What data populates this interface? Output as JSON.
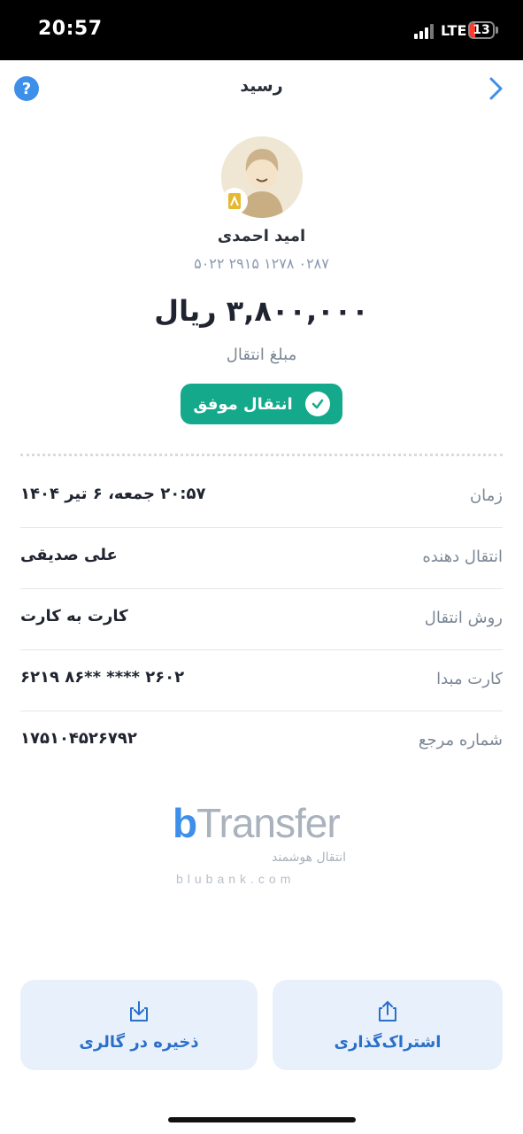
{
  "status_bar": {
    "time": "20:57",
    "network": "LTE",
    "battery_level": "13"
  },
  "header": {
    "title": "رسید"
  },
  "recipient": {
    "name": "امید احمدی",
    "card_number": "۵۰۲۲ ۲۹۱۵ ۱۲۷۸ ۰۲۸۷"
  },
  "amount": {
    "value": "۳,۸۰۰,۰۰۰ ریال",
    "label": "مبلغ انتقال"
  },
  "status": {
    "label": "انتقال موفق",
    "color": "#14a98b"
  },
  "details": [
    {
      "label": "زمان",
      "value": "۲۰:۵۷ جمعه، ۶ تیر ۱۴۰۴"
    },
    {
      "label": "انتقال دهنده",
      "value": "علی صدیقی"
    },
    {
      "label": "روش انتقال",
      "value": "کارت به کارت"
    },
    {
      "label": "کارت مبدا",
      "value": "۶۲۱۹ ۸۶** **** ۲۶۰۲"
    },
    {
      "label": "شماره مرجع",
      "value": "۱۷۵۱۰۴۵۲۶۷۹۲"
    }
  ],
  "brand": {
    "name_b": "b",
    "name_rest": "Transfer",
    "tagline_fa": "انتقال هوشمند",
    "url": "blubank.com"
  },
  "actions": {
    "save_label": "ذخیره در گالری",
    "share_label": "اشتراک‌گذاری"
  },
  "colors": {
    "accent": "#3d8fea",
    "success": "#14a98b",
    "button_bg": "#e8f1fb"
  }
}
